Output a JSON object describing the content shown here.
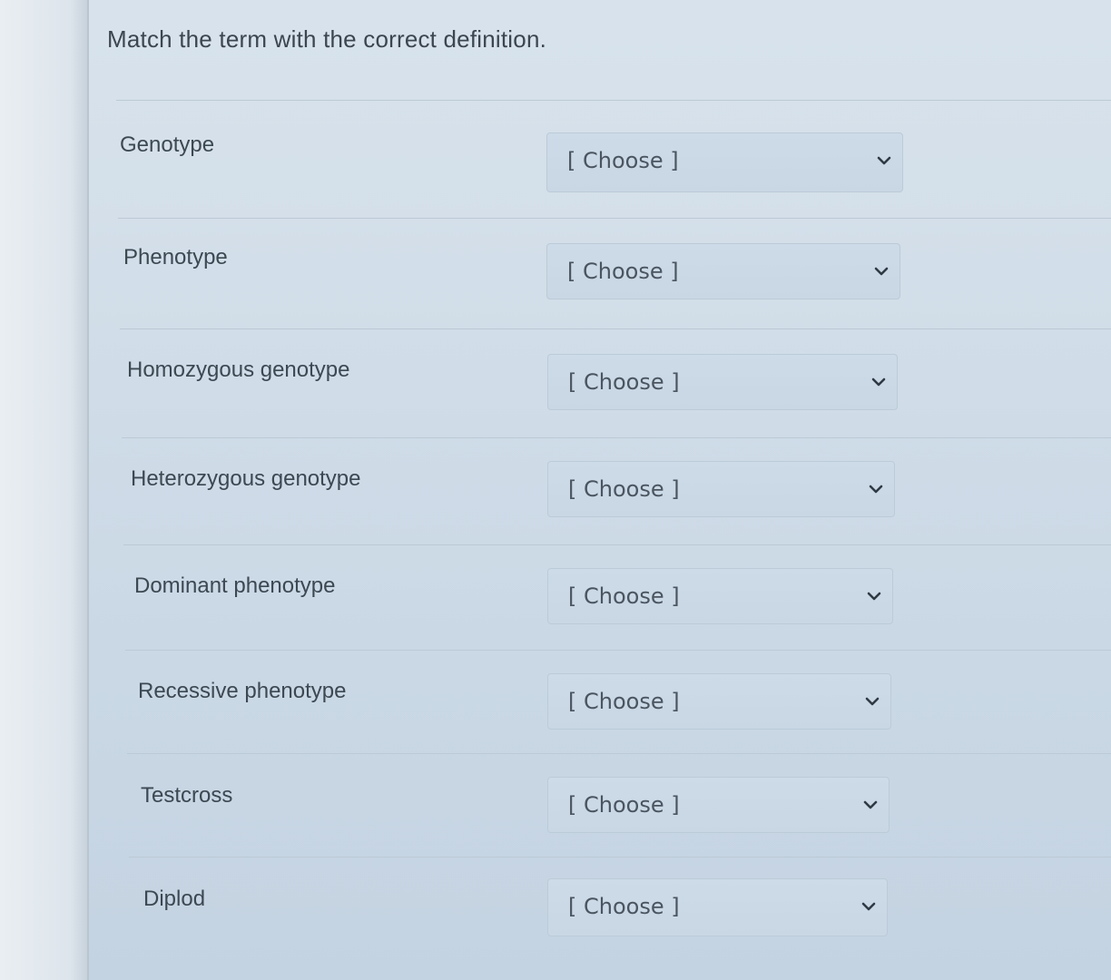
{
  "question": "Match the term with the correct definition.",
  "rows": [
    {
      "term": "Genotype",
      "selected": "[ Choose ]"
    },
    {
      "term": "Phenotype",
      "selected": "[ Choose ]"
    },
    {
      "term": "Homozygous genotype",
      "selected": "[ Choose ]"
    },
    {
      "term": "Heterozygous genotype",
      "selected": "[ Choose ]"
    },
    {
      "term": "Dominant phenotype",
      "selected": "[ Choose ]"
    },
    {
      "term": "Recessive phenotype",
      "selected": "[ Choose ]"
    },
    {
      "term": "Testcross",
      "selected": "[ Choose ]"
    },
    {
      "term": "Diplod",
      "selected": "[ Choose ]"
    }
  ],
  "icons": {
    "dropdown": "chevron-down-icon"
  }
}
